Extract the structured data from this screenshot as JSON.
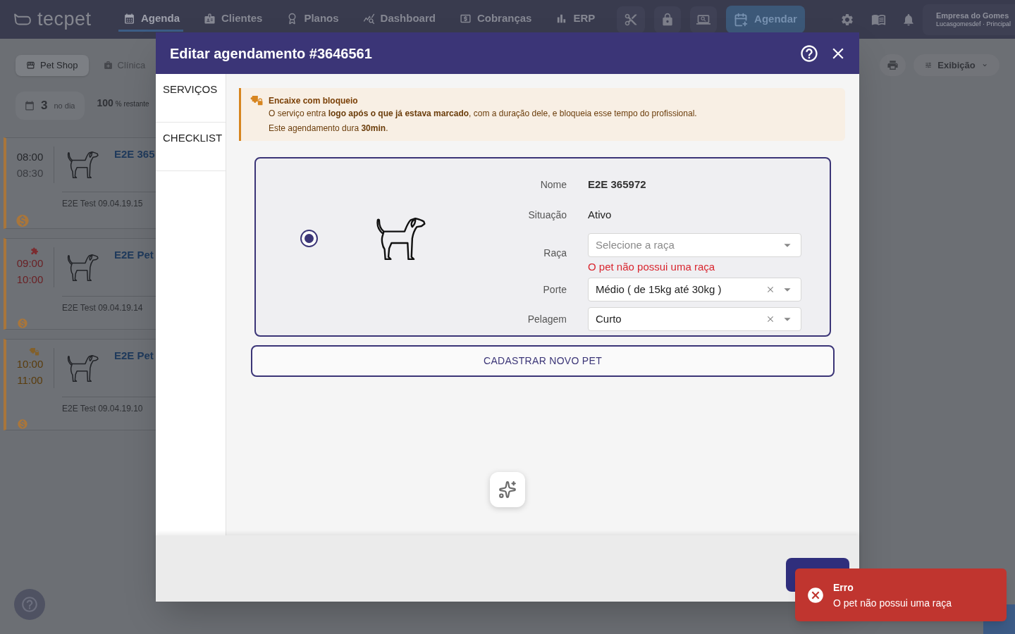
{
  "nav": {
    "logo": "tecpet",
    "items": [
      {
        "label": "Agenda",
        "selected": true
      },
      {
        "label": "Clientes",
        "selected": false
      },
      {
        "label": "Planos",
        "selected": false
      },
      {
        "label": "Dashboard",
        "selected": false
      },
      {
        "label": "Cobranças",
        "selected": false
      },
      {
        "label": "ERP",
        "selected": false
      }
    ],
    "schedule_button": "Agendar",
    "company": {
      "name": "Empresa do Gomes",
      "detail": "Lucasgomesdef · Principal"
    }
  },
  "toolbar": {
    "segments": [
      {
        "label": "Pet Shop",
        "selected": true
      },
      {
        "label": "Clínica",
        "selected": false
      }
    ],
    "view_button": "Exibição"
  },
  "summary": {
    "count": "3",
    "count_label": "no dia",
    "percent": "100",
    "percent_label": "% restante"
  },
  "appointments": [
    {
      "kind": "regular",
      "start": "08:00",
      "end": "08:30",
      "pet": "E2E 365",
      "client": "E2E Test 09.04.19.15"
    },
    {
      "kind": "fit",
      "start": "09:00",
      "end": "10:00",
      "pet": "E2E Pet",
      "client": "E2E Test 09.04.19.14"
    },
    {
      "kind": "fit_block",
      "start": "10:00",
      "end": "11:00",
      "pet": "E2E Pet",
      "client": "E2E Test 09.04.19.10"
    }
  ],
  "modal": {
    "title": "Editar agendamento #3646561",
    "tabs": [
      {
        "label": "SERVIÇOS",
        "selected": false
      },
      {
        "label": "CHECKLIST",
        "selected": false
      }
    ],
    "alert": {
      "title": "Encaixe com bloqueio",
      "message": "O serviço entra **logo após o que já estava marcado**, com a duração dele, e bloqueia esse tempo do profissional.",
      "note": "Este agendamento dura **30min**."
    },
    "pet": {
      "selected": true,
      "fields": [
        {
          "kind": "name",
          "label": "Nome",
          "value": "E2E 365972"
        },
        {
          "kind": "text",
          "label": "Situação",
          "value": "Ativo"
        },
        {
          "kind": "select",
          "label": "Raça",
          "placeholder": "Selecione a raça",
          "error": "O pet não possui uma raça"
        },
        {
          "kind": "select",
          "label": "Porte",
          "value": "Médio ( de 15kg até 30kg )"
        },
        {
          "kind": "select",
          "label": "Pelagem",
          "value": "Curto"
        }
      ]
    },
    "register_button": "CADASTRAR NOVO PET"
  },
  "toast": {
    "title": "Erro",
    "message": "O pet não possui uma raça"
  }
}
